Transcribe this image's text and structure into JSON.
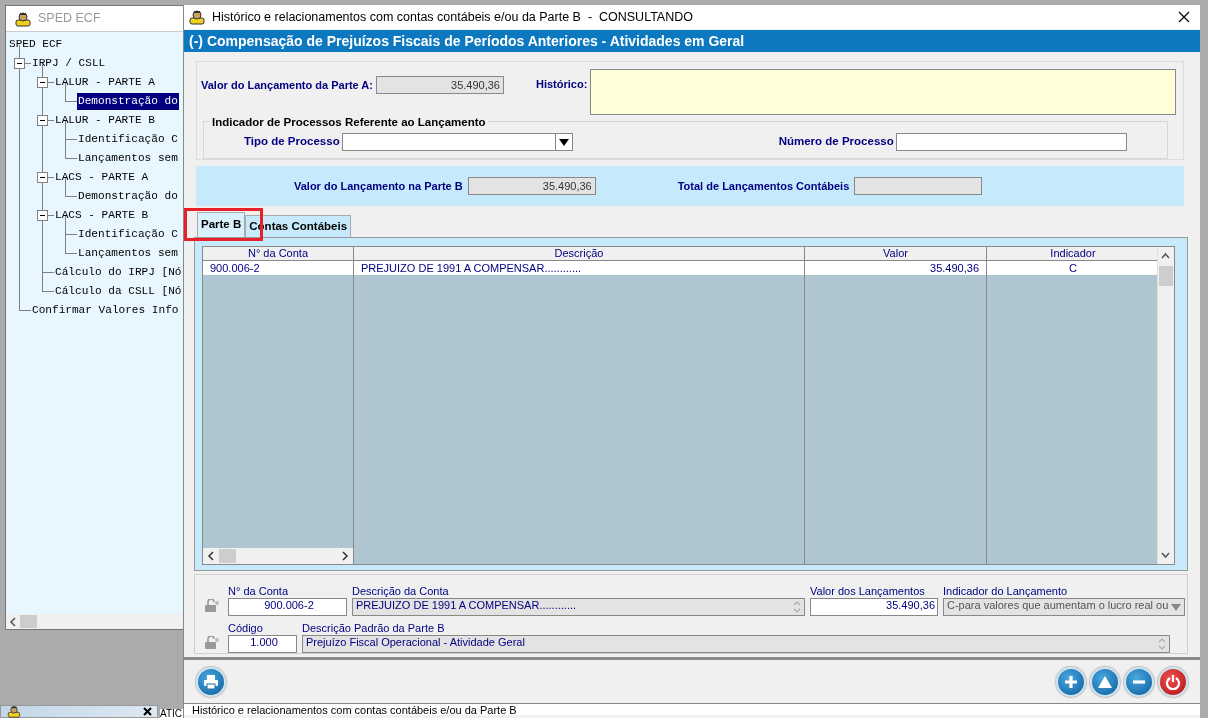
{
  "background_window": {
    "title": "SPED ECF",
    "tree": [
      {
        "label": "SPED ECF",
        "selected": false,
        "children": [
          {
            "label": "IRPJ / CSLL",
            "selected": false,
            "expanded": true,
            "children": [
              {
                "label": "LALUR - PARTE A",
                "selected": false,
                "expanded": true,
                "children": [
                  {
                    "label": "Demonstração do",
                    "selected": true
                  }
                ]
              },
              {
                "label": "LALUR - PARTE B",
                "selected": false,
                "expanded": true,
                "children": [
                  {
                    "label": "Identificação C",
                    "selected": false
                  },
                  {
                    "label": "Lançamentos sem",
                    "selected": false
                  }
                ]
              },
              {
                "label": "LACS - PARTE A",
                "selected": false,
                "expanded": true,
                "children": [
                  {
                    "label": "Demonstração do",
                    "selected": false
                  }
                ]
              },
              {
                "label": "LACS - PARTE B",
                "selected": false,
                "expanded": true,
                "children": [
                  {
                    "label": "Identificação C",
                    "selected": false
                  },
                  {
                    "label": "Lançamentos sem",
                    "selected": false
                  }
                ]
              },
              {
                "label": "Cálculo do IRPJ [Nó",
                "selected": false
              },
              {
                "label": "Cálculo da CSLL [Nó",
                "selected": false
              }
            ]
          },
          {
            "label": "Confirmar Valores Info",
            "selected": false
          }
        ]
      }
    ]
  },
  "minimized_window": {
    "label": "ATIC"
  },
  "dialog": {
    "title": "Histórico e relacionamentos com contas contábeis e/ou da Parte B  -  CONSULTANDO",
    "header": "(-) Compensação de Prejuízos Fiscais de Períodos Anteriores - Atividades em Geral",
    "valor_parte_a": {
      "label": "Valor do Lançamento da Parte A:",
      "value": "35.490,36",
      "disabled": true
    },
    "historico": {
      "label": "Histórico:"
    },
    "processos": {
      "title": "Indicador de Processos Referente ao Lançamento",
      "tipo": {
        "label": "Tipo de Processo"
      },
      "numero": {
        "label": "Número de Processo"
      }
    },
    "valor_parte_b": {
      "label": "Valor do Lançamento na Parte B",
      "value": "35.490,36",
      "disabled": true
    },
    "total_contabeis": {
      "label": "Total de Lançamentos Contábeis",
      "disabled": true
    },
    "tabs": [
      {
        "label": "Parte B",
        "selected": true,
        "highlighted": true
      },
      {
        "label": "Contas Contábeis",
        "selected": false,
        "highlighted": false
      }
    ],
    "table": {
      "columns": [
        "N° da Conta",
        "Descrição",
        "Valor",
        "Indicador"
      ],
      "rows": [
        [
          "900.006-2",
          "PREJUIZO DE 1991 A COMPENSAR............",
          "35.490,36",
          "C"
        ]
      ]
    },
    "detail": [
      [
        {
          "label": "N° da Conta",
          "value": "900.006-2",
          "disabled": false,
          "kind": "text"
        },
        {
          "label": "Descrição da Conta",
          "value": "PREJUIZO DE 1991 A COMPENSAR............",
          "disabled": true,
          "kind": "memo"
        },
        {
          "label": "Valor dos Lançamentos",
          "value": "35.490,36",
          "disabled": false,
          "kind": "text"
        },
        {
          "label": "Indicador do Lançamento",
          "value": "C-para valores que aumentam o lucro real ou",
          "disabled": true,
          "kind": "combo"
        }
      ],
      [
        {
          "label": "Código",
          "value": "1.000",
          "disabled": false,
          "kind": "text"
        },
        {
          "label": "Descrição Padrão da Parte B",
          "value": "Prejuízo Fiscal Operacional - Atividade Geral",
          "disabled": true,
          "kind": "memo"
        }
      ]
    ],
    "buttons": [
      {
        "kind": "print"
      },
      {
        "kind": "add"
      },
      {
        "kind": "up"
      },
      {
        "kind": "remove"
      },
      {
        "kind": "power"
      }
    ],
    "status_bar": "Histórico e relacionamentos com contas contábeis e/ou da Parte B"
  }
}
